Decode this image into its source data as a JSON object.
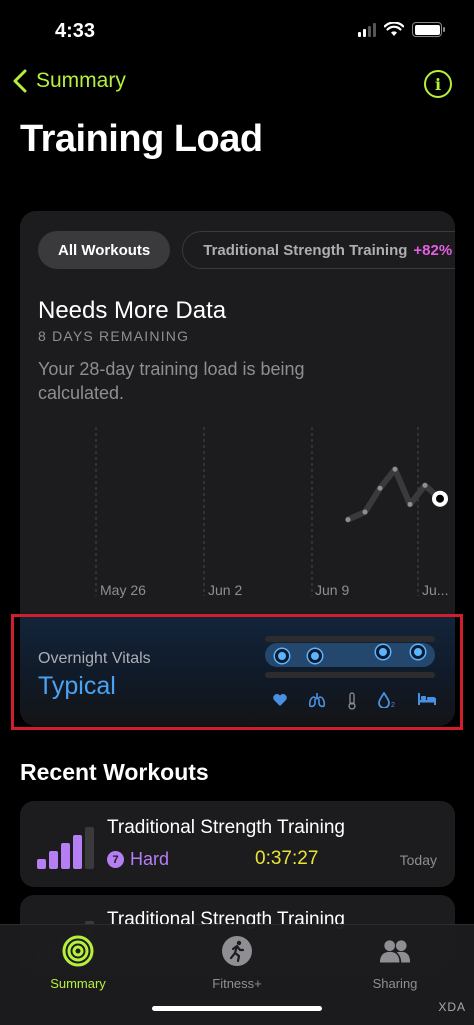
{
  "status_bar": {
    "time": "4:33"
  },
  "nav": {
    "back_label": "Summary"
  },
  "page": {
    "title": "Training Load"
  },
  "filters": [
    {
      "label": "All Workouts"
    },
    {
      "label": "Traditional Strength Training",
      "delta": "+82%"
    }
  ],
  "status": {
    "title": "Needs More Data",
    "subtitle": "8 DAYS REMAINING",
    "description": "Your 28-day training load is being calculated."
  },
  "chart_data": {
    "type": "line",
    "x_ticks": [
      "May 26",
      "Jun 2",
      "Jun 9",
      "Ju..."
    ],
    "grid": "vertical dashed",
    "y_axis": "unlabeled",
    "values": [
      0.12,
      0.2,
      0.45,
      0.65,
      0.28,
      0.48,
      0.34
    ],
    "current_value": 0.34
  },
  "vitals": {
    "label": "Overnight Vitals",
    "value": "Typical",
    "indicators": [
      {
        "icon": "heart-icon",
        "level": 0.1
      },
      {
        "icon": "lungs-icon",
        "level": 0.3
      },
      {
        "icon": "thermometer-icon",
        "level": null
      },
      {
        "icon": "blood-oxygen-icon",
        "level": 0.7
      },
      {
        "icon": "bed-icon",
        "level": 0.9
      }
    ]
  },
  "recent": {
    "title": "Recent Workouts",
    "items": [
      {
        "name": "Traditional Strength Training",
        "effort_num": "7",
        "effort_label": "Hard",
        "duration": "0:37:27",
        "date": "Today"
      },
      {
        "name": "Traditional Strength Training"
      }
    ]
  },
  "tabs": [
    {
      "label": "Summary",
      "icon": "activity-rings-icon",
      "active": true
    },
    {
      "label": "Fitness+",
      "icon": "runner-icon",
      "active": false
    },
    {
      "label": "Sharing",
      "icon": "people-icon",
      "active": false
    }
  ],
  "watermark": "XDA",
  "colors": {
    "accent": "#b6f03c",
    "vitals": "#4aa3f2",
    "effort": "#b57ef3",
    "duration": "#e8e43a",
    "delta": "#e45ee4",
    "highlight": "#d11e2d"
  }
}
